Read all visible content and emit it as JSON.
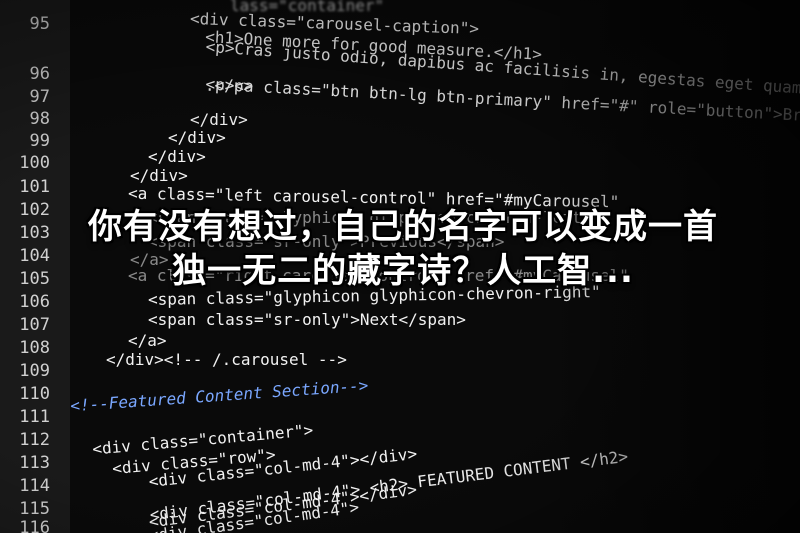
{
  "line_numbers": [
    "95",
    "96",
    "97",
    "98",
    "99",
    "100",
    "101",
    "102",
    "103",
    "104",
    "105",
    "106",
    "107",
    "108",
    "109",
    "110",
    "111",
    "112",
    "113",
    "114",
    "115",
    "116"
  ],
  "code_lines": [
    "lass=\"container\"",
    "<div class=\"carousel-caption\">",
    "<h1>One more for good measure.</h1>",
    "<p>Cras justo odio, dapibus ac facilisis in, egestas eget quam.",
    ".</p>",
    "<p><a class=\"btn btn-lg btn-primary\" href=\"#\" role=\"button\">Browse gallery</a>",
    "</div>",
    "</div>",
    "</div>",
    "</div>",
    "<a class=\"left carousel-control\" href=\"#myCarousel\"",
    "<span class=\"glyphicon glyphicon-chevron-left\"",
    "<span class=\"sr-only\">Previous</span>",
    "</a>",
    "<a class=\"right carousel-control\" href=\"#myCarousel\"",
    "<span class=\"glyphicon glyphicon-chevron-right\"",
    "<span class=\"sr-only\">Next</span>",
    "</a>",
    "</div><!-- /.carousel -->",
    "<!--Featured Content Section-->",
    "<div class=\"container\">",
    "<div class=\"row\">",
    "<div class=\"col-md-4\"></div>",
    "<div class=\"col-md-4\"> <h2> FEATURED CONTENT </h2>",
    "<div class=\"col-md-4\"></div>",
    "<div class=\"col-md-4\">"
  ],
  "headline": "你有没有想过，自己的名字可以变成一首独一无二的藏字诗？人工智..."
}
